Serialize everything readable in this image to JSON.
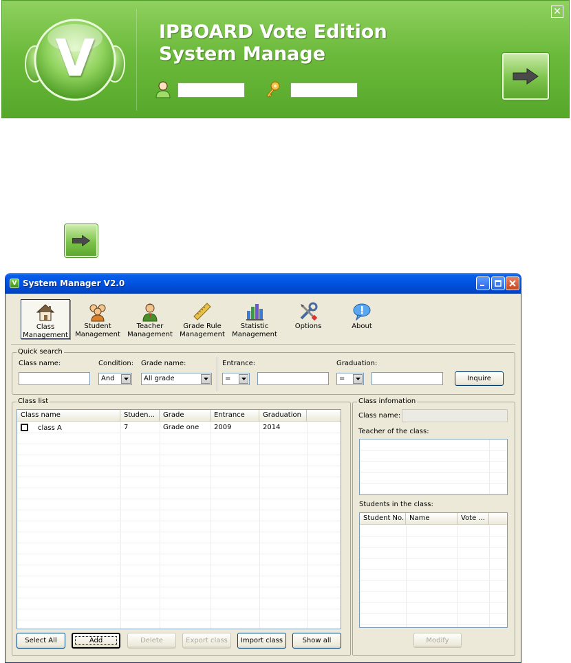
{
  "banner": {
    "title_line1": "IPBOARD Vote Edition",
    "title_line2": "System Manage",
    "logo_letter": "V",
    "username_value": "",
    "password_value": "",
    "close_glyph": "✕",
    "icons": [
      "user-icon",
      "key-icon",
      "arrow-right-icon"
    ],
    "accent_color": "#6cba3c"
  },
  "window": {
    "title": "System Manager V2.0",
    "app_icon_letter": "V",
    "controls": {
      "minimize": "_",
      "maximize": "□",
      "close": "✕"
    }
  },
  "toolbar": {
    "items": [
      {
        "label": "Class Management",
        "icon": "house-icon",
        "active": true
      },
      {
        "label": "Student Management",
        "icon": "students-icon"
      },
      {
        "label": "Teacher Management",
        "icon": "teacher-icon"
      },
      {
        "label": "Grade Rule Management",
        "icon": "ruler-icon"
      },
      {
        "label": "Statistic Management",
        "icon": "bar-chart-icon"
      },
      {
        "label": "Options",
        "icon": "tools-icon"
      },
      {
        "label": "About",
        "icon": "info-bubble-icon"
      }
    ]
  },
  "quick_search": {
    "title": "Quick search",
    "class_name_label": "Class name:",
    "class_name_value": "",
    "condition_label": "Condition:",
    "condition_value": "And",
    "grade_label": "Grade name:",
    "grade_value": "All grade",
    "entrance_label": "Entrance:",
    "entrance_op": "=",
    "entrance_value": "",
    "graduation_label": "Graduation:",
    "graduation_op": "=",
    "graduation_value": "",
    "inquire_button": "Inquire"
  },
  "class_list": {
    "title": "Class list",
    "columns": [
      "Class name",
      "Studen...",
      "Grade",
      "Entrance",
      "Graduation"
    ],
    "rows": [
      {
        "name": "class A",
        "students": "7",
        "grade": "Grade one",
        "entrance": "2009",
        "graduation": "2014"
      }
    ],
    "buttons": {
      "select_all": "Select All",
      "add": "Add",
      "delete": "Delete",
      "export": "Export class",
      "import": "Import class",
      "show_all": "Show all"
    }
  },
  "class_info": {
    "title": "Class infomation",
    "class_name_label": "Class name:",
    "class_name_value": "",
    "teacher_label": "Teacher of the class:",
    "students_label": "Students in the class:",
    "student_columns": [
      "Student No.",
      "Name",
      "Vote ..."
    ],
    "modify_button": "Modify"
  }
}
